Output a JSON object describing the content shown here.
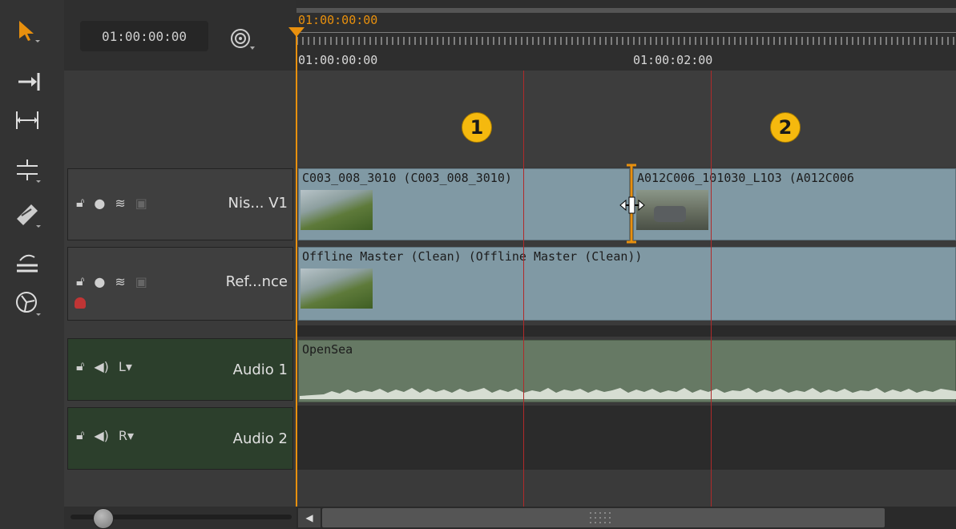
{
  "header": {
    "timecode": "01:00:00:00",
    "playhead_timecode": "01:00:00:00",
    "ruler_labels": [
      "01:00:00:00",
      "01:00:02:00"
    ]
  },
  "markers": [
    "1",
    "2"
  ],
  "tracks": [
    {
      "name": "Nis... V1",
      "type": "video",
      "clips": [
        {
          "label": "C003_008_3010 (C003_008_3010)"
        },
        {
          "label": "A012C006_101030_L1O3 (A012C006"
        }
      ]
    },
    {
      "name": "Ref...nce",
      "type": "video",
      "clips": [
        {
          "label": "Offline Master (Clean) (Offline Master (Clean))"
        }
      ]
    },
    {
      "name": "Audio 1",
      "type": "audio",
      "channel": "L",
      "clips": [
        {
          "label": "OpenSea"
        }
      ]
    },
    {
      "name": "Audio 2",
      "type": "audio",
      "channel": "R",
      "clips": []
    }
  ],
  "icons": [
    "select-arrow-icon",
    "ripple-icon",
    "slip-icon",
    "slide-icon",
    "razor-icon",
    "multi-icon",
    "retime-icon",
    "sync-icon",
    "lock-icon",
    "eye-icon",
    "layers-icon",
    "blend-icon",
    "speaker-icon",
    "tag-icon"
  ],
  "colors": {
    "playhead": "#e8900e",
    "marker_line": "#b02a2a",
    "video_clip": "#8099a4",
    "audio_clip": "#667964",
    "audio_head": "#2c3f2c",
    "badge": "#f5b90e"
  }
}
